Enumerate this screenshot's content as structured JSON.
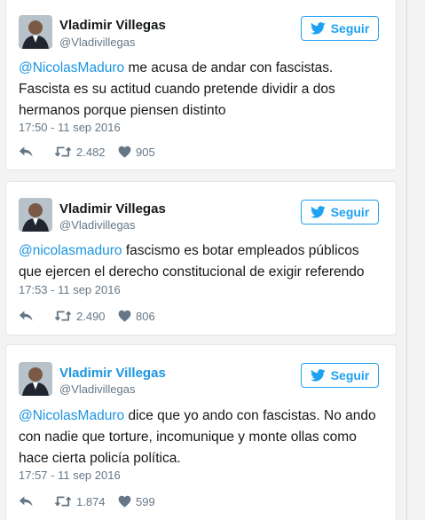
{
  "tweets": [
    {
      "name": "Vladimir Villegas",
      "handle": "@Vladivillegas",
      "follow_label": "Seguir",
      "mention": "@NicolasMaduro",
      "text_lines": [
        "me acusa de andar con fascistas.",
        "Fascista es su actitud cuando pretende dividir a dos",
        "hermanos porque piensen distinto"
      ],
      "timestamp": "17:50 - 11 sep 2016",
      "retweets": "2.482",
      "likes": "905"
    },
    {
      "name": "Vladimir Villegas",
      "handle": "@Vladivillegas",
      "follow_label": "Seguir",
      "mention": "@nicolasmaduro",
      "text_lines": [
        "fascismo es botar empleados públicos",
        "que ejercen el derecho constitucional de exigir referendo"
      ],
      "timestamp": "17:53 - 11 sep 2016",
      "retweets": "2.490",
      "likes": "806"
    },
    {
      "name": "Vladimir Villegas",
      "handle": "@Vladivillegas",
      "follow_label": "Seguir",
      "mention": "@NicolasMaduro",
      "text_lines": [
        "dice que yo ando con fascistas. No ando",
        "con nadie que torture, incomunique y monte ollas como",
        "hace cierta policía política."
      ],
      "timestamp": "17:57 - 11 sep 2016",
      "retweets": "1.874",
      "likes": "599"
    }
  ],
  "icons": {
    "follow": "twitter-bird-icon",
    "reply": "reply-icon",
    "retweet": "retweet-icon",
    "like": "heart-icon"
  },
  "colors": {
    "link": "#1b95e0",
    "follow": "#1da1f2",
    "muted": "#657786",
    "text": "#14171a"
  }
}
